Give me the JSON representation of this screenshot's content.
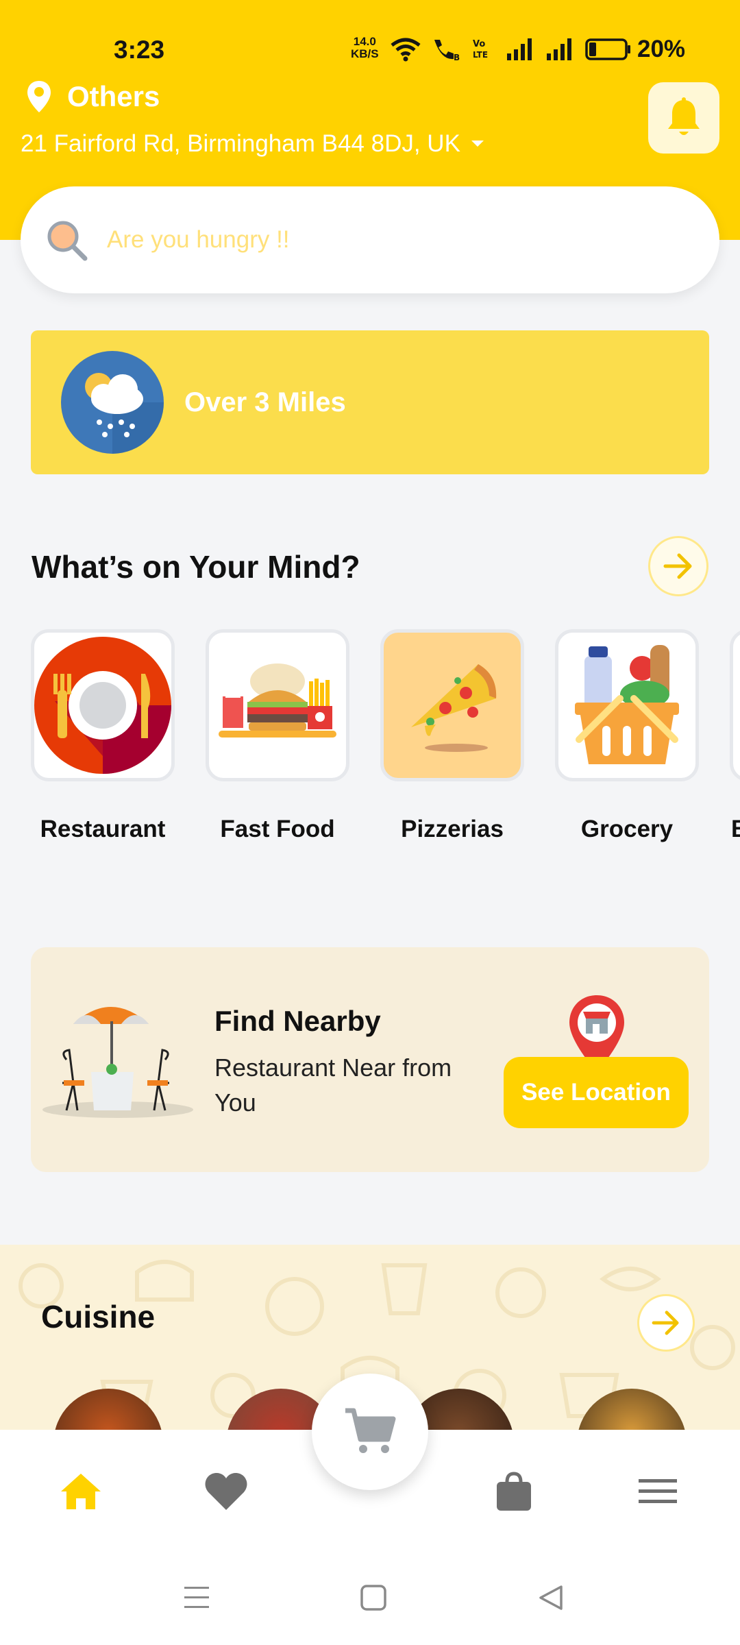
{
  "status_bar": {
    "time": "3:23",
    "speed_value": "14.0",
    "speed_unit": "KB/S",
    "battery": "20%"
  },
  "header": {
    "location_label": "Others",
    "address": "21 Fairford Rd, Birmingham B44 8DJ, UK",
    "icons": [
      "location-pin-icon",
      "chevron-down-icon",
      "bell-icon"
    ]
  },
  "search": {
    "placeholder": "Are you hungry !!"
  },
  "weather": {
    "label": "Over 3 Miles"
  },
  "categories_section": {
    "title": "What’s on Your Mind?",
    "items": [
      {
        "label": "Restaurant"
      },
      {
        "label": "Fast Food"
      },
      {
        "label": "Pizzerias"
      },
      {
        "label": "Grocery"
      },
      {
        "label": "B"
      }
    ]
  },
  "nearby": {
    "title": "Find Nearby",
    "subtitle": "Restaurant Near from You",
    "button_label": "See Location"
  },
  "cuisine": {
    "title": "Cuisine"
  },
  "bottom_nav": {
    "items": [
      "home-icon",
      "heart-icon",
      "cart-icon",
      "bag-icon",
      "menu-icon"
    ],
    "active": "home-icon"
  },
  "colors": {
    "brand_yellow": "#FFD200",
    "banner_yellow": "#FBDD4C",
    "card_cream": "#F7EEDA"
  }
}
